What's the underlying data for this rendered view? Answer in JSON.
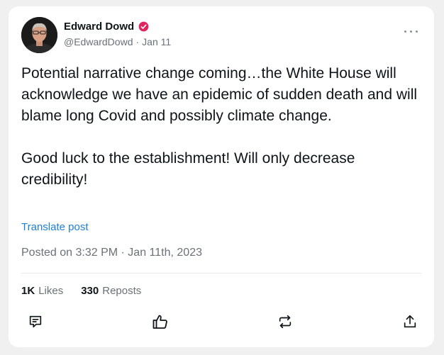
{
  "author": {
    "display_name": "Edward Dowd",
    "handle": "@EdwardDowd",
    "separator": "·",
    "date": "Jan 11",
    "verified": true,
    "verified_color": "#e0245e"
  },
  "tweet": {
    "text": "Potential narrative change coming…the White House will acknowledge we have an epidemic of sudden death and will blame long Covid and possibly climate change.\n\nGood luck to the establishment! Will only decrease credibility!",
    "translate_label": "Translate post",
    "posted_label": "Posted on 3:32 PM · Jan 11th, 2023"
  },
  "stats": {
    "likes_count": "1K",
    "likes_label": "Likes",
    "reposts_count": "330",
    "reposts_label": "Reposts"
  },
  "actions": {
    "reply_icon": "reply-icon",
    "like_icon": "thumbs-up-icon",
    "repost_icon": "repost-icon",
    "share_icon": "share-icon"
  },
  "colors": {
    "link": "#1d7fd6",
    "secondary_text": "#6b7176",
    "primary_text": "#0f1419"
  }
}
